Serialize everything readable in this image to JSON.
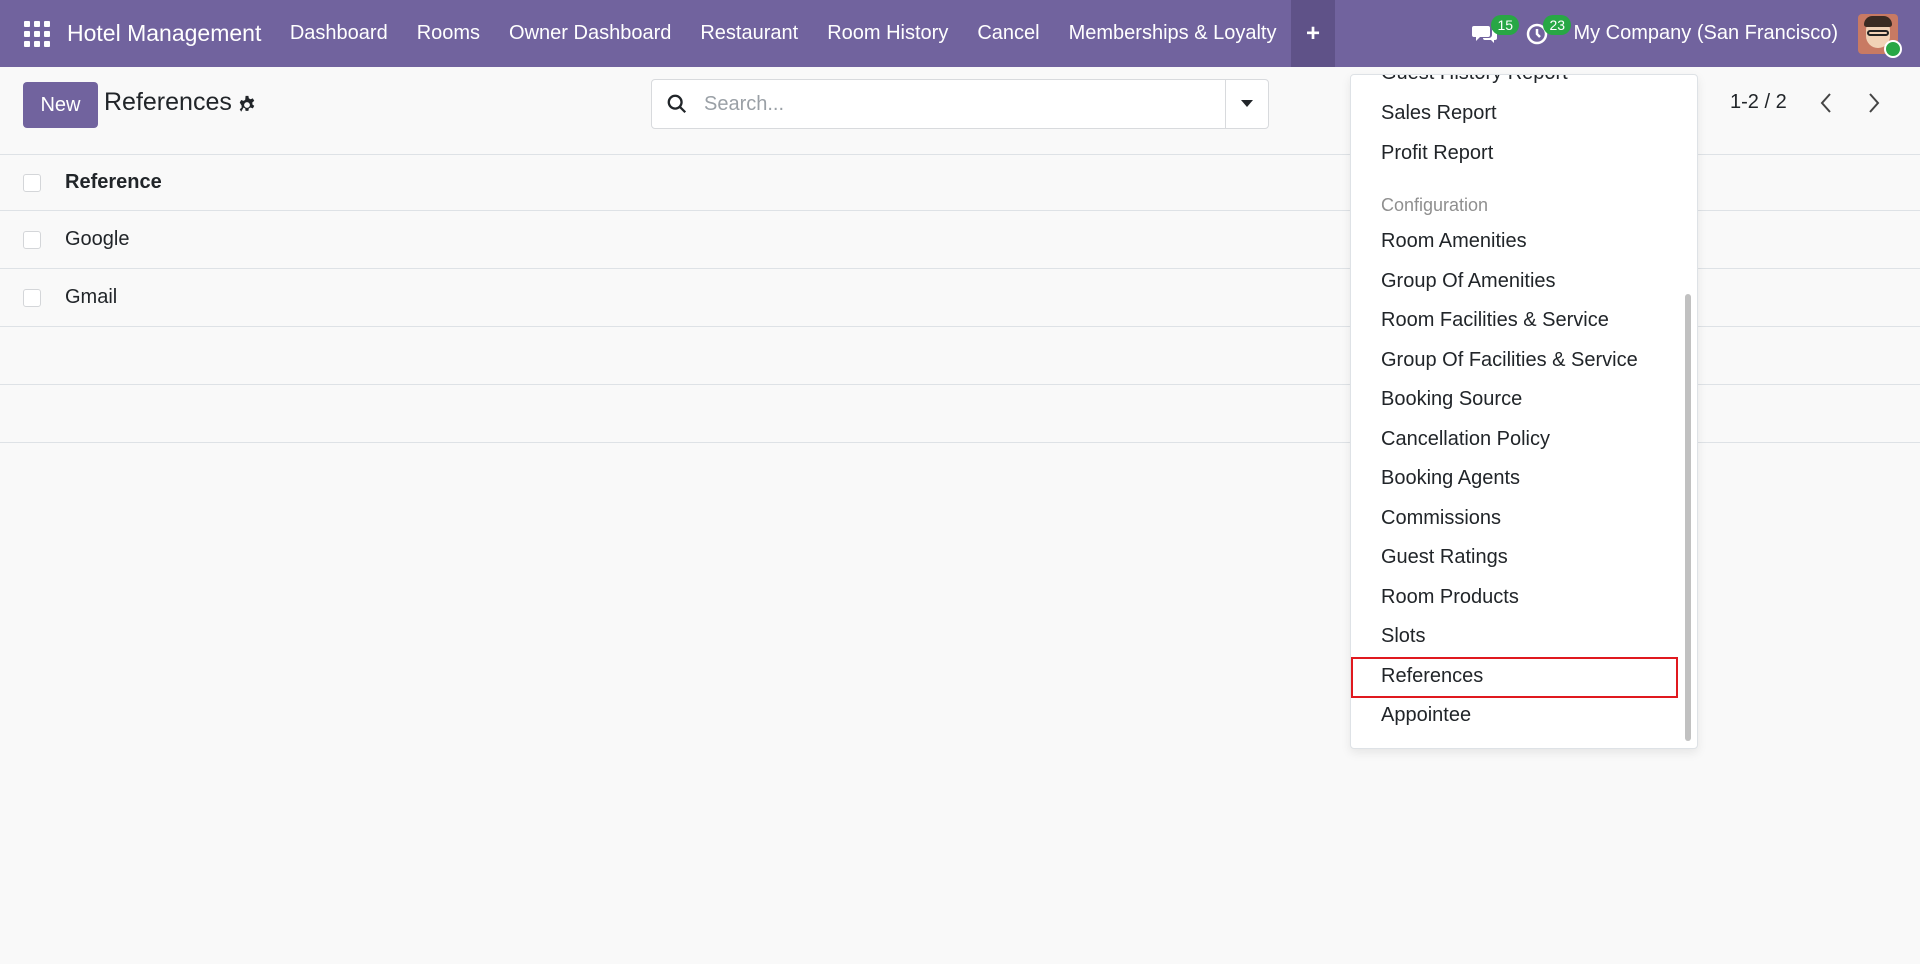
{
  "navbar": {
    "brand": "Hotel Management",
    "menu": [
      "Dashboard",
      "Rooms",
      "Owner Dashboard",
      "Restaurant",
      "Room History",
      "Cancel",
      "Memberships & Loyalty"
    ],
    "plus": "+",
    "messages_count": "15",
    "activities_count": "23",
    "company": "My Company (San Francisco)"
  },
  "control": {
    "new_label": "New",
    "title": "References",
    "search_placeholder": "Search...",
    "pager": "1-2 / 2"
  },
  "list": {
    "column": "Reference",
    "rows": [
      "Google",
      "Gmail"
    ]
  },
  "dropdown": {
    "items_top": [
      "Guest History Report",
      "Sales Report",
      "Profit Report"
    ],
    "section": "Configuration",
    "items": [
      "Room Amenities",
      "Group Of Amenities",
      "Room Facilities & Service",
      "Group Of Facilities & Service",
      "Booking Source",
      "Cancellation Policy",
      "Booking Agents",
      "Commissions",
      "Guest Ratings",
      "Room Products",
      "Slots",
      "References",
      "Appointee"
    ]
  },
  "colors": {
    "brand": "#71639e",
    "highlight": "#e0191f",
    "badge": "#28a745"
  }
}
